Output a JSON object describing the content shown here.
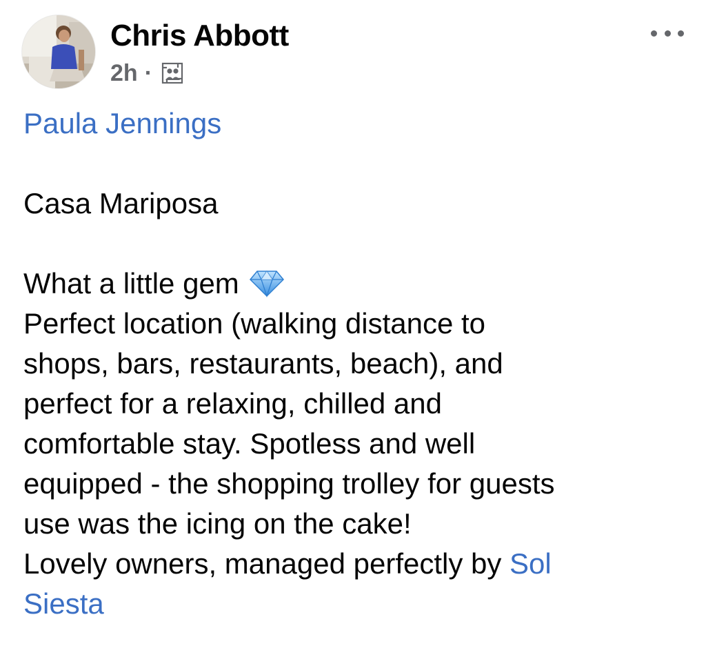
{
  "post": {
    "author": "Chris Abbott",
    "time": "2h",
    "separator": "·",
    "audience_icon": "tagged-photo-icon",
    "more_icon": "more-options-icon",
    "mention": "Paula Jennings",
    "place": "Casa Mariposa",
    "line1": "What a little gem",
    "gem_icon": "gem-stone-emoji",
    "line2": "Perfect location (walking distance to",
    "line3": "shops, bars, restaurants, beach), and",
    "line4": "perfect for a relaxing, chilled and",
    "line5": "comfortable stay. Spotless and well",
    "line6": "equipped - the shopping trolley for guests",
    "line7": "use was the icing on the cake!",
    "line8_text": "Lovely owners, managed perfectly by ",
    "line8_link": "Sol",
    "line9_link": "Siesta"
  },
  "colors": {
    "link": "#3b6fc4",
    "secondary_text": "#65676b",
    "primary_text": "#050505"
  }
}
